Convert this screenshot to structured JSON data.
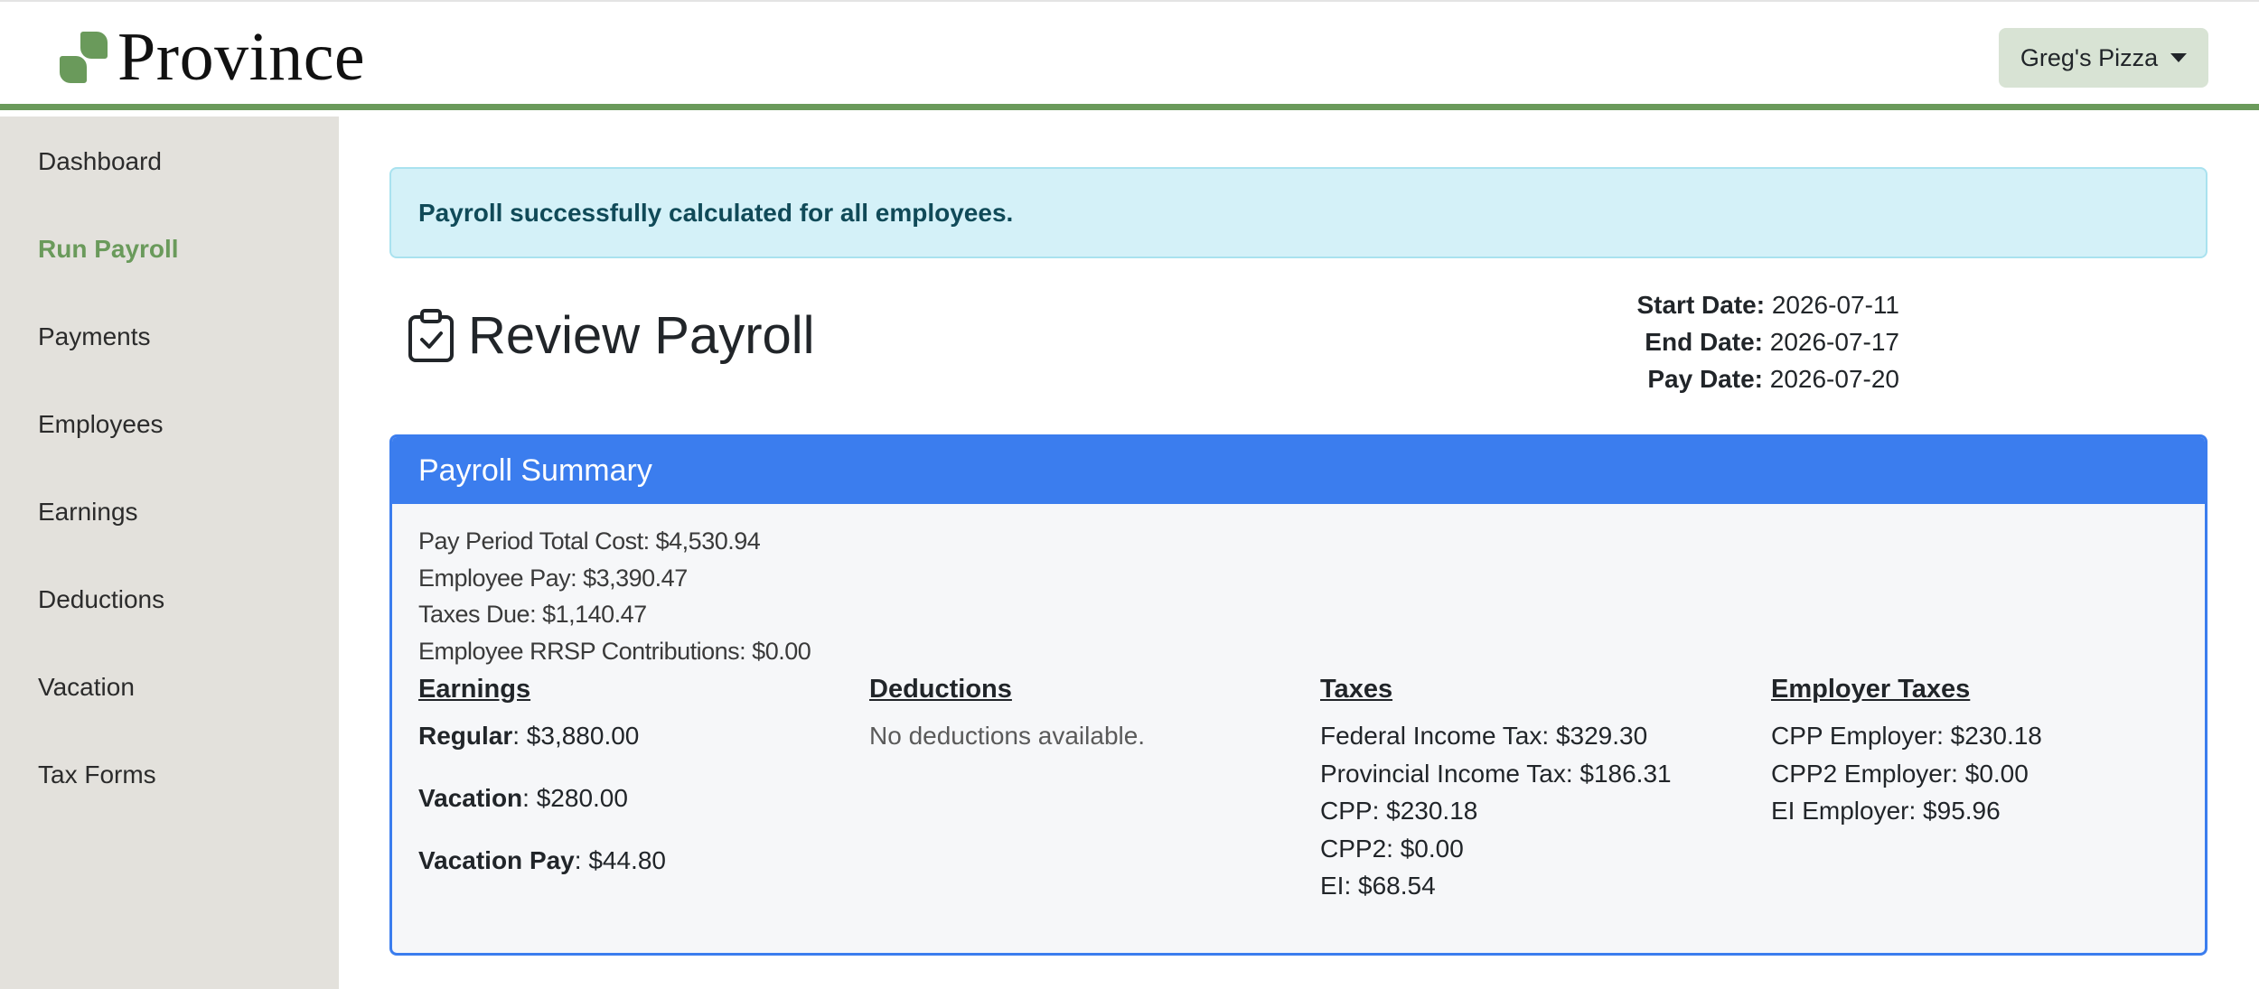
{
  "brand": {
    "name": "Province",
    "primary_color": "#6a9a5b"
  },
  "account_menu": {
    "label": "Greg's Pizza",
    "icon": "caret-down-icon"
  },
  "sidebar": {
    "items": [
      {
        "label": "Dashboard",
        "active": false
      },
      {
        "label": "Run Payroll",
        "active": true
      },
      {
        "label": "Payments",
        "active": false
      },
      {
        "label": "Employees",
        "active": false
      },
      {
        "label": "Earnings",
        "active": false
      },
      {
        "label": "Deductions",
        "active": false
      },
      {
        "label": "Vacation",
        "active": false
      },
      {
        "label": "Tax Forms",
        "active": false
      }
    ]
  },
  "alert": {
    "message": "Payroll successfully calculated for all employees."
  },
  "page": {
    "title": "Review Payroll",
    "icon": "clipboard-check-icon",
    "dates": {
      "start_label": "Start Date:",
      "start_value": "2026-07-11",
      "end_label": "End Date:",
      "end_value": "2026-07-17",
      "pay_label": "Pay Date:",
      "pay_value": "2026-07-20"
    }
  },
  "summary": {
    "title": "Payroll Summary",
    "accent_color": "#3b7dee",
    "lines": [
      "Pay Period Total Cost: $4,530.94",
      "Employee Pay: $3,390.47",
      "Taxes Due: $1,140.47",
      "Employee RRSP Contributions: $0.00"
    ],
    "earnings": {
      "heading": "Earnings",
      "items": [
        {
          "label": "Regular",
          "value": ": $3,880.00"
        },
        {
          "label": "Vacation",
          "value": ": $280.00"
        },
        {
          "label": "Vacation Pay",
          "value": ": $44.80"
        }
      ]
    },
    "deductions": {
      "heading": "Deductions",
      "empty_message": "No deductions available."
    },
    "taxes": {
      "heading": "Taxes",
      "items": [
        "Federal Income Tax: $329.30",
        "Provincial Income Tax: $186.31",
        "CPP: $230.18",
        "CPP2: $0.00",
        "EI: $68.54"
      ]
    },
    "employer_taxes": {
      "heading": "Employer Taxes",
      "items": [
        "CPP Employer: $230.18",
        "CPP2 Employer: $0.00",
        "EI Employer: $95.96"
      ]
    }
  }
}
